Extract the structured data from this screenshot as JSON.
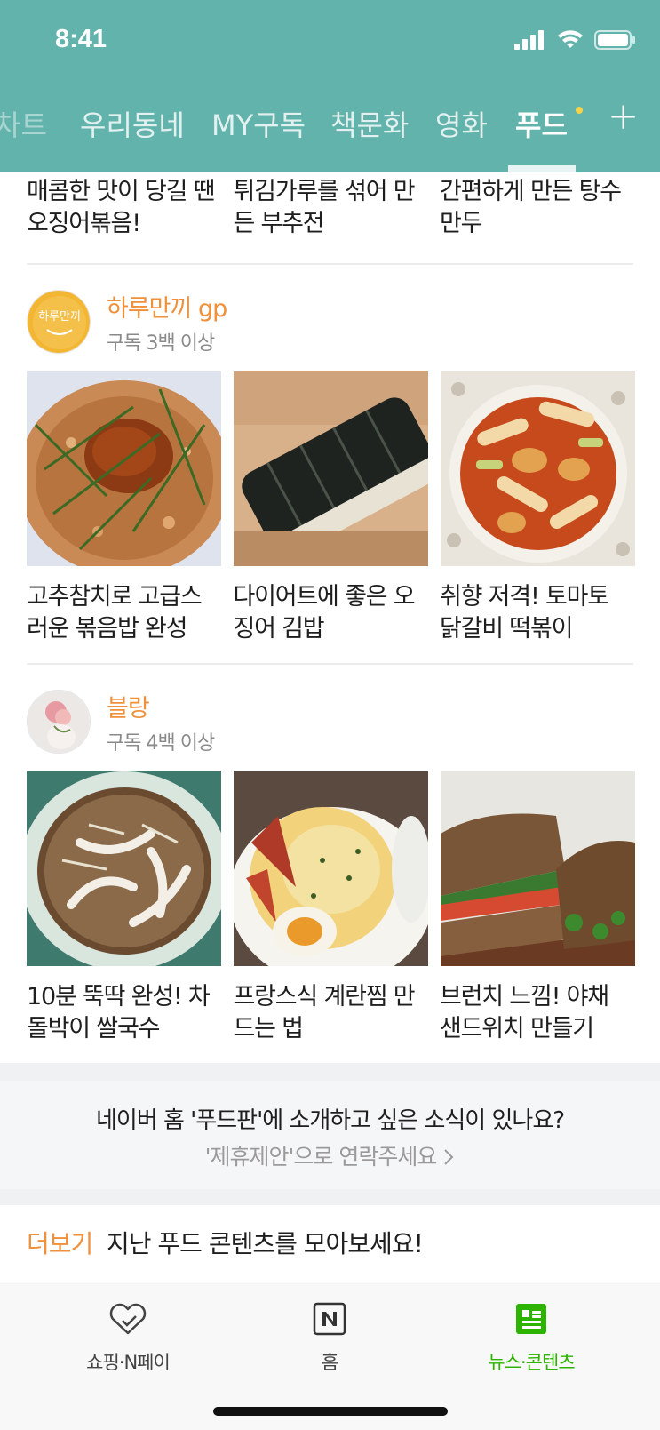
{
  "status_bar": {
    "time": "8:41"
  },
  "tabs": {
    "items": [
      {
        "label": "차트",
        "state": "faded"
      },
      {
        "label": "우리동네",
        "state": "normal"
      },
      {
        "label": "MY구독",
        "state": "normal"
      },
      {
        "label": "책문화",
        "state": "normal"
      },
      {
        "label": "영화",
        "state": "normal"
      },
      {
        "label": "푸드",
        "state": "active"
      }
    ],
    "add_label": "+"
  },
  "top_captions": [
    "매콤한 맛이 당길 땐 오징어볶음!",
    "튀김가루를 섞어 만든 부추전",
    "간편하게 만든 탕수만두"
  ],
  "sections": [
    {
      "author": "하루만끼 gp",
      "subscribers": "구독 3백 이상",
      "avatar_text": "하루만끼",
      "items": [
        {
          "title": "고추참치로 고급스러운 볶음밥 완성",
          "image": "fried-rice-image"
        },
        {
          "title": "다이어트에 좋은 오징어 김밥",
          "image": "kimbap-image"
        },
        {
          "title": "취향 저격! 토마토 닭갈비 떡볶이",
          "image": "tteokbokki-image"
        }
      ]
    },
    {
      "author": "블랑",
      "subscribers": "구독 4백 이상",
      "items": [
        {
          "title": "10분 뚝딱 완성! 차돌박이 쌀국수",
          "image": "noodle-soup-image"
        },
        {
          "title": "프랑스식 계란찜 만드는 법",
          "image": "egg-casserole-image"
        },
        {
          "title": "브런치 느낌! 야채 샌드위치 만들기",
          "image": "sandwich-image"
        }
      ]
    }
  ],
  "partner": {
    "title": "네이버 홈 '푸드판'에 소개하고 싶은 소식이 있나요?",
    "link": "'제휴제안'으로 연락주세요"
  },
  "more": {
    "label": "더보기",
    "text": "지난 푸드 콘텐츠를 모아보세요!"
  },
  "bottom_nav": [
    {
      "label": "쇼핑·N페이",
      "icon": "shopping-heart-icon"
    },
    {
      "label": "홈",
      "icon": "naver-n-icon"
    },
    {
      "label": "뉴스·콘텐츠",
      "icon": "news-content-icon",
      "active": true
    }
  ],
  "colors": {
    "header": "#62b3ab",
    "accent_orange": "#f0903a",
    "active_green": "#2db400"
  }
}
